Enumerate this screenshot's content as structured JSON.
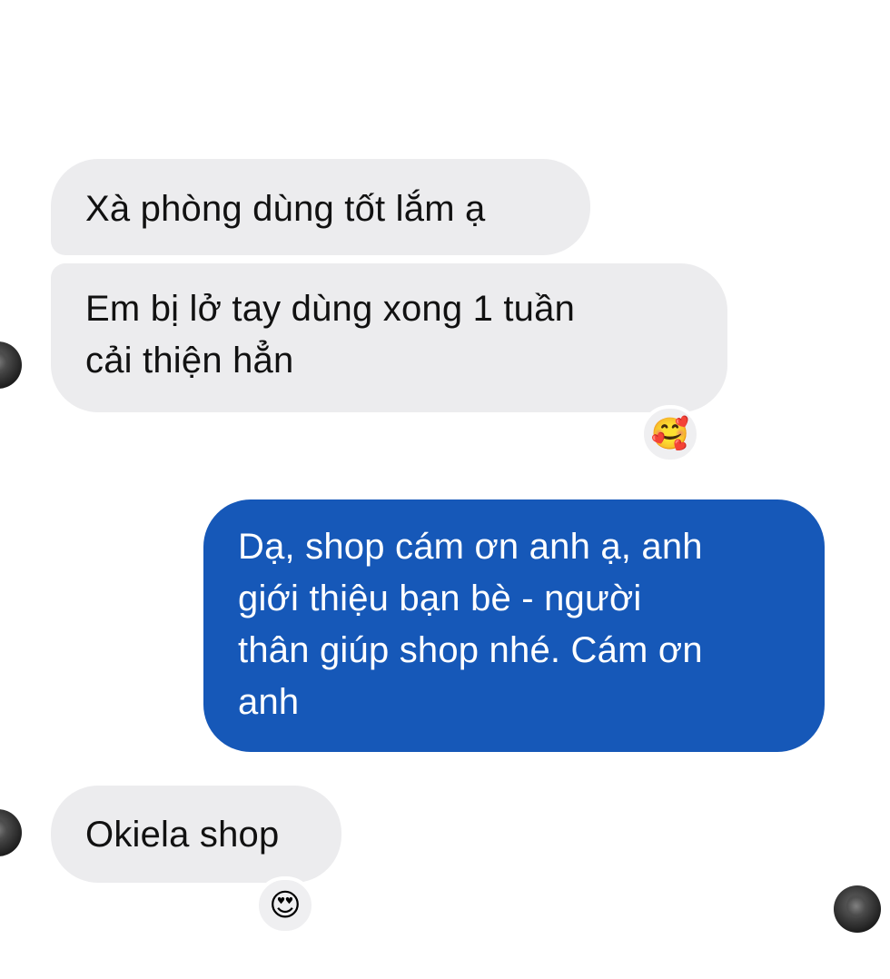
{
  "messages": [
    {
      "id": "msg1",
      "direction": "incoming",
      "text": "Xà phòng dùng tốt lắm ạ"
    },
    {
      "id": "msg2",
      "direction": "incoming",
      "text_lines": [
        "Em bị lở tay dùng xong 1 tuần",
        "cải thiện hẳn"
      ],
      "reaction": "🥰"
    },
    {
      "id": "msg3",
      "direction": "outgoing",
      "text_lines": [
        "Dạ, shop cám ơn anh ạ, anh",
        "giới thiệu bạn bè - người",
        "thân giúp shop nhé. Cám ơn",
        "anh"
      ]
    },
    {
      "id": "msg4",
      "direction": "incoming",
      "text": "Okiela shop",
      "reaction": "😍"
    }
  ],
  "colors": {
    "incoming_bubble": "#ececee",
    "outgoing_bubble": "#1658b8",
    "incoming_text": "#111111",
    "outgoing_text": "#ffffff"
  },
  "icons": {
    "reaction_1": "smiling-face-with-hearts-emoji",
    "reaction_2": "heart-eyes-emoji",
    "avatar": "contact-avatar-photo",
    "read_receipt": "seen-avatar"
  }
}
